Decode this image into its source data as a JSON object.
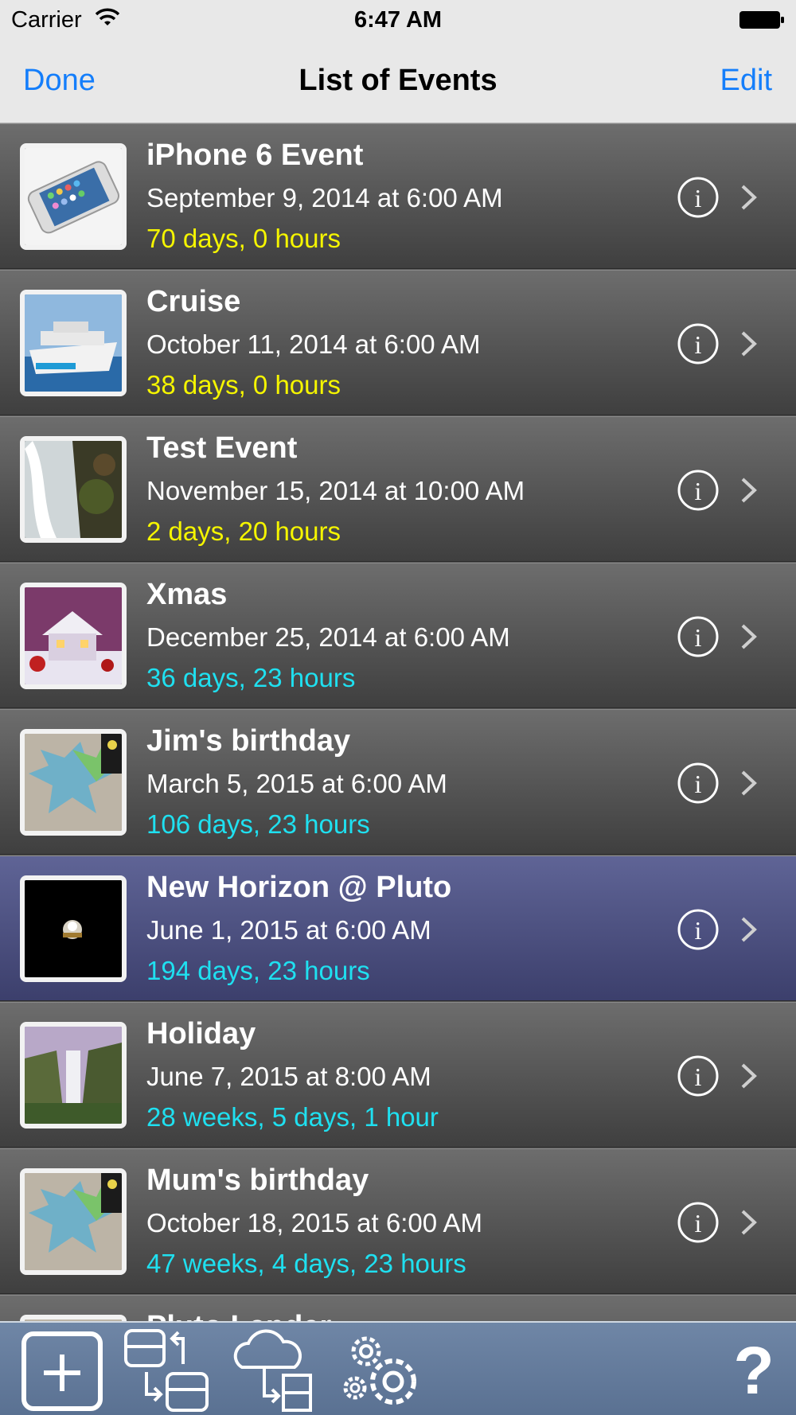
{
  "status_bar": {
    "carrier": "Carrier",
    "time": "6:47 AM"
  },
  "nav": {
    "done_label": "Done",
    "title": "List of Events",
    "edit_label": "Edit"
  },
  "colors": {
    "accent": "#147efb",
    "count_yellow": "#f5f500",
    "count_cyan": "#1fe0f0",
    "highlight_row": "#4f5486"
  },
  "events": [
    {
      "name": "iPhone 6 Event",
      "date": "September 9, 2014 at 6:00 AM",
      "countdown": "70 days, 0 hours",
      "countdown_color": "yellow",
      "thumbnail": "iphone-photo"
    },
    {
      "name": "Cruise",
      "date": "October 11, 2014 at 6:00 AM",
      "countdown": "38 days, 0 hours",
      "countdown_color": "yellow",
      "thumbnail": "cruise-ship-photo"
    },
    {
      "name": "Test Event",
      "date": "November 15, 2014 at 10:00 AM",
      "countdown": "2 days, 20 hours",
      "countdown_color": "yellow",
      "thumbnail": "waterfall-photo"
    },
    {
      "name": "Xmas",
      "date": "December 25, 2014 at 6:00 AM",
      "countdown": "36 days, 23 hours",
      "countdown_color": "cyan",
      "thumbnail": "christmas-house-photo"
    },
    {
      "name": "Jim's birthday",
      "date": "March 5, 2015 at 6:00 AM",
      "countdown": "106 days, 23 hours",
      "countdown_color": "cyan",
      "thumbnail": "balloons-photo"
    },
    {
      "name": "New Horizon @ Pluto",
      "date": "June 1, 2015 at 6:00 AM",
      "countdown": "194 days, 23 hours",
      "countdown_color": "cyan",
      "thumbnail": "space-probe-photo",
      "highlighted": true
    },
    {
      "name": "Holiday",
      "date": "June 7, 2015 at 8:00 AM",
      "countdown": "28 weeks, 5 days, 1 hour",
      "countdown_color": "cyan",
      "thumbnail": "waterfall-valley-photo"
    },
    {
      "name": "Mum's birthday",
      "date": "October 18, 2015 at 6:00 AM",
      "countdown": "47 weeks, 4 days, 23 hours",
      "countdown_color": "cyan",
      "thumbnail": "balloons-photo"
    },
    {
      "name": "Pluto Lander",
      "date": "",
      "countdown": "",
      "countdown_color": "cyan",
      "thumbnail": "balloons-photo"
    }
  ],
  "toolbar": {
    "items": [
      "add-event-icon",
      "sync-database-icon",
      "cloud-sync-icon",
      "settings-gears-icon",
      "help-icon"
    ],
    "help_label": "?"
  }
}
